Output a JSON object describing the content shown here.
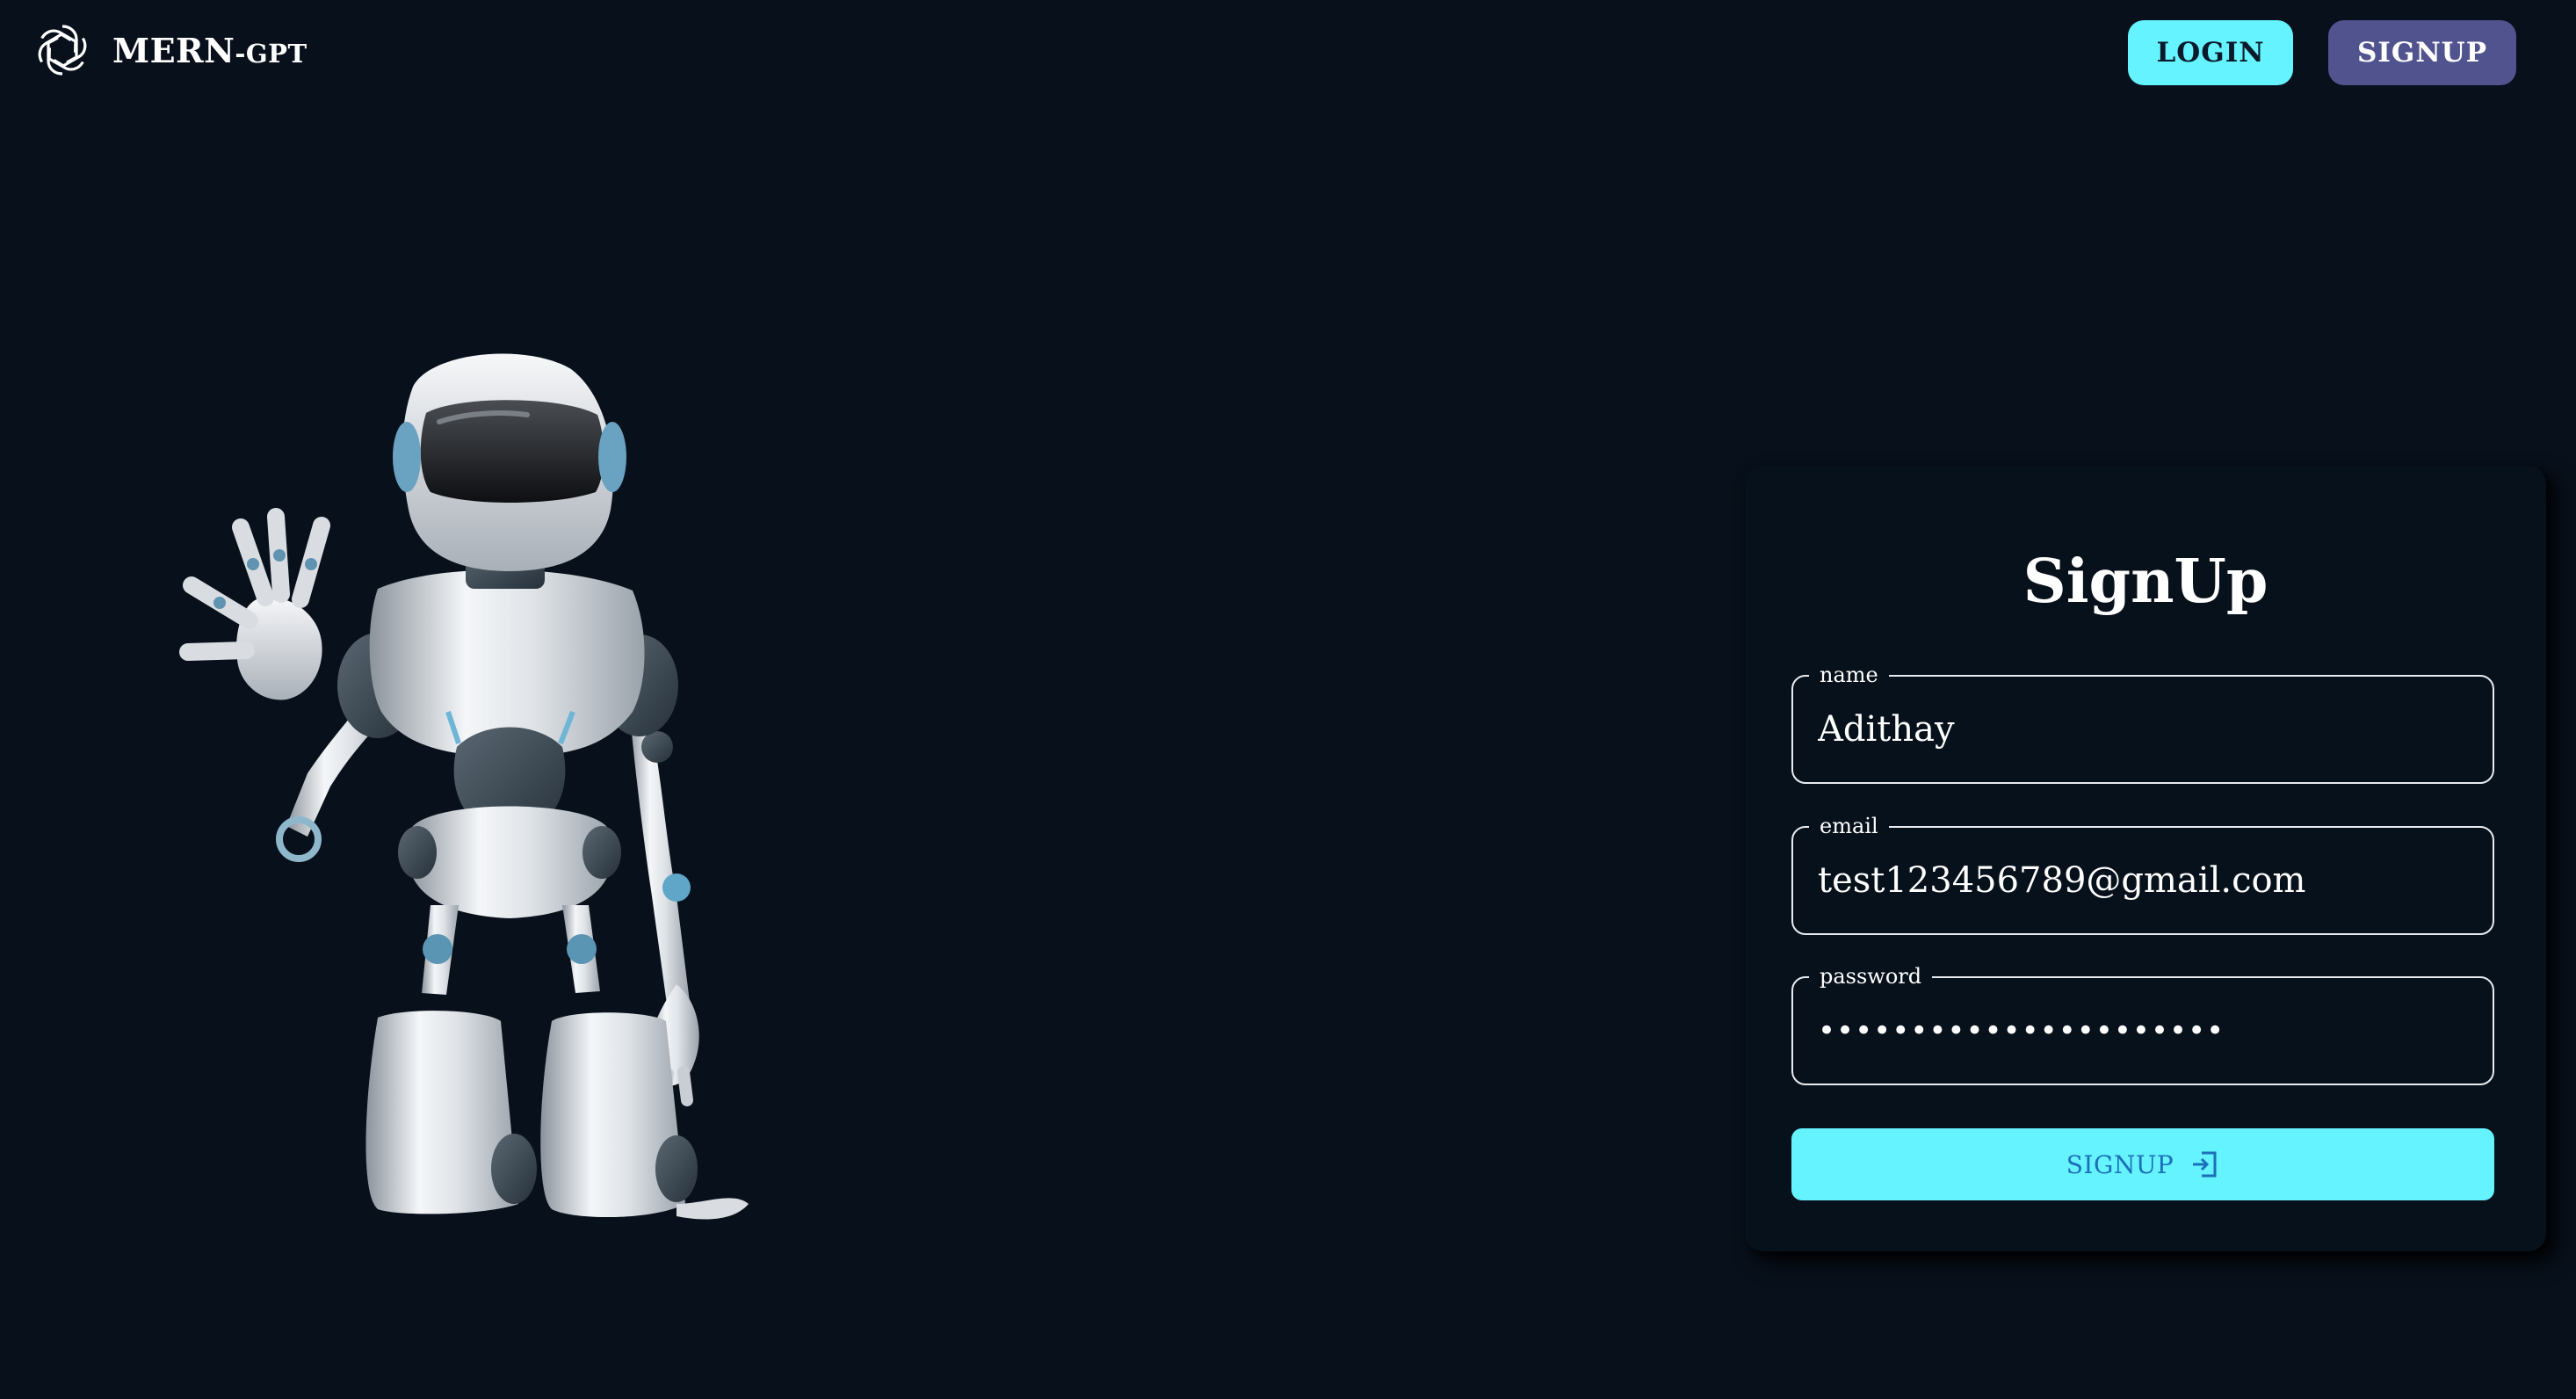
{
  "header": {
    "brand_name": "MERN",
    "brand_suffix": "-GPT",
    "login_label": "LOGIN",
    "signup_label": "SIGNUP",
    "logo_icon": "openai-logo-icon"
  },
  "hero": {
    "image_icon": "waving-robot-image"
  },
  "signup_form": {
    "title": "SignUp",
    "fields": [
      {
        "label": "name",
        "value": "Adithay",
        "type": "text"
      },
      {
        "label": "email",
        "value": "test123456789@gmail.com",
        "type": "email"
      },
      {
        "label": "password",
        "value": "••••••••••••••••••••••",
        "type": "password"
      }
    ],
    "submit_label": "SIGNUP",
    "submit_icon": "login-icon"
  },
  "colors": {
    "background": "#08101b",
    "card_background": "#07111b",
    "accent_cyan": "#64f3ff",
    "signup_button": "#51538f",
    "submit_text": "#1c6fb8"
  }
}
